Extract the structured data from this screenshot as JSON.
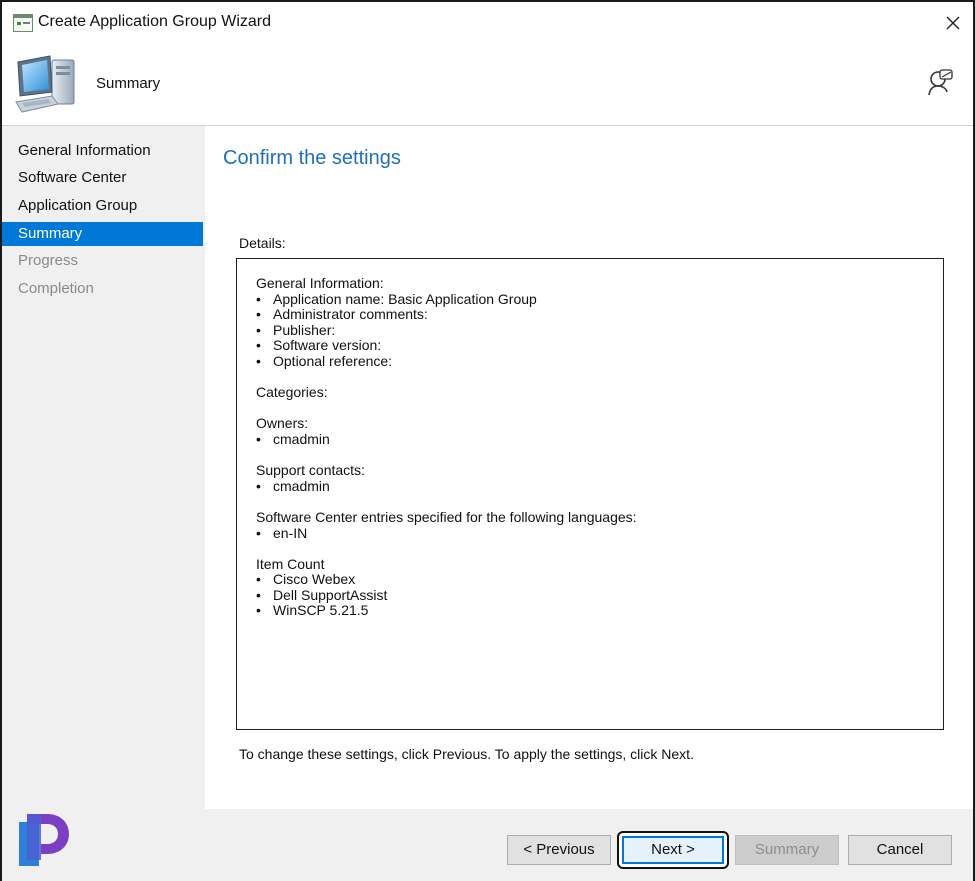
{
  "window": {
    "title": "Create Application Group Wizard"
  },
  "header": {
    "title": "Summary"
  },
  "sidebar": {
    "items": [
      {
        "label": "General Information"
      },
      {
        "label": "Software Center"
      },
      {
        "label": "Application Group"
      },
      {
        "label": "Summary"
      },
      {
        "label": "Progress"
      },
      {
        "label": "Completion"
      }
    ]
  },
  "content": {
    "title": "Confirm the settings",
    "details_label": "Details:",
    "details": {
      "general": {
        "heading": "General Information:",
        "items": [
          "Application name: Basic Application Group",
          "Administrator comments:",
          "Publisher:",
          "Software version:",
          "Optional reference:"
        ]
      },
      "categories": {
        "heading": "Categories:"
      },
      "owners": {
        "heading": "Owners:",
        "items": [
          "cmadmin"
        ]
      },
      "support": {
        "heading": "Support contacts:",
        "items": [
          "cmadmin"
        ]
      },
      "languages": {
        "heading": "Software Center entries specified for the following languages:",
        "items": [
          "en-IN"
        ]
      },
      "item_count": {
        "heading": "Item Count",
        "items": [
          "Cisco Webex",
          "Dell SupportAssist",
          "WinSCP 5.21.5"
        ]
      }
    },
    "footnote": "To change these settings, click Previous. To apply the settings, click Next."
  },
  "buttons": {
    "previous": "< Previous",
    "next": "Next >",
    "summary": "Summary",
    "cancel": "Cancel"
  },
  "colors": {
    "accent": "#0078d7",
    "title_blue": "#1f6fbf",
    "sidebar_bg": "#f0f0f0"
  },
  "icons": [
    "app-window-icon",
    "close-icon",
    "computer-icon",
    "help-icon",
    "logo-icon"
  ]
}
